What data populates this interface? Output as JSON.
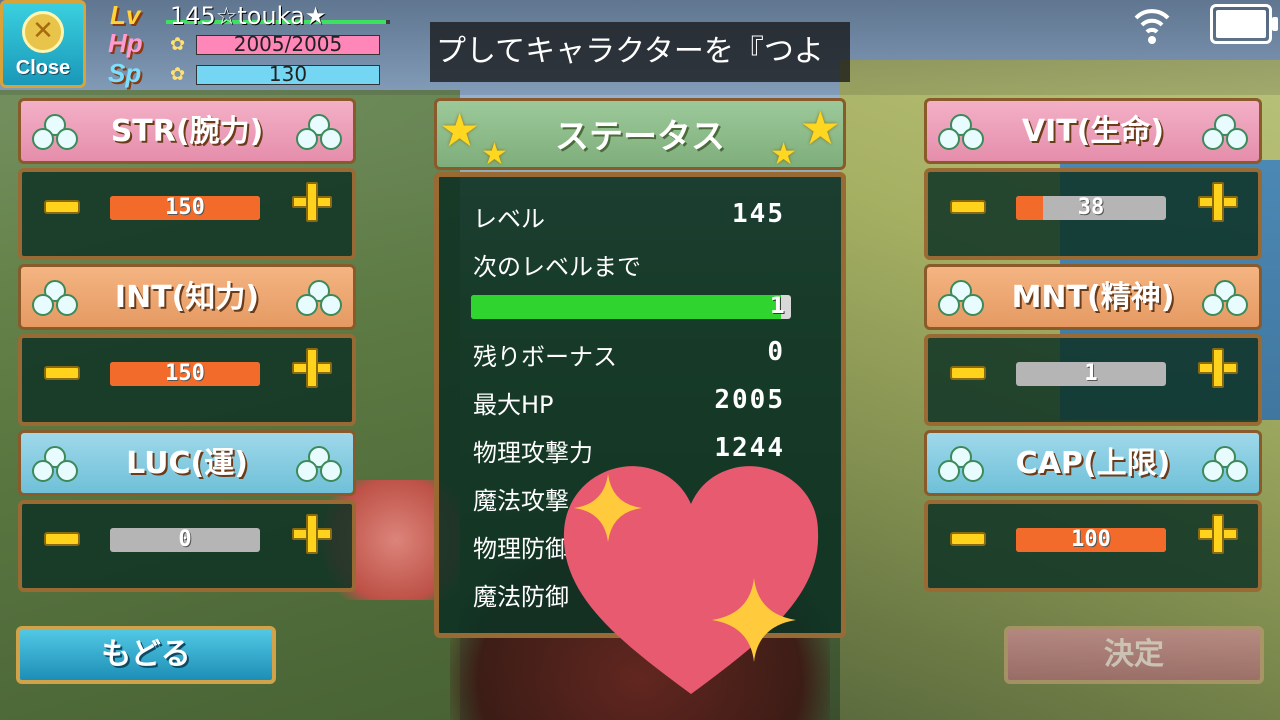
{
  "hud": {
    "close_label": "Close",
    "lv_key": "Lv",
    "hp_key": "Hp",
    "sp_key": "Sp",
    "level_name": "145☆touka★",
    "hp_text": "2005/2005",
    "sp_text": "130",
    "hp_fraction": 1.0,
    "sp_fraction": 1.0,
    "lv_fraction": 0.98,
    "ticker": "プしてキャラクターを『つよ"
  },
  "panels": {
    "str": {
      "title": "STR(腕力)",
      "value": "150",
      "fraction": 1.0
    },
    "int": {
      "title": "INT(知力)",
      "value": "150",
      "fraction": 1.0
    },
    "luc": {
      "title": "LUC(運)",
      "value": "0",
      "fraction": 0.0
    },
    "vit": {
      "title": "VIT(生命)",
      "value": "38",
      "fraction": 0.18
    },
    "mnt": {
      "title": "MNT(精神)",
      "value": "1",
      "fraction": 0.0
    },
    "cap": {
      "title": "CAP(上限)",
      "value": "100",
      "fraction": 1.0
    }
  },
  "status": {
    "title": "ステータス",
    "level_label": "レベル",
    "level_value": "145",
    "next_label": "次のレベルまで",
    "next_value": "1",
    "next_fraction": 0.97,
    "bonus_label": "残りボーナス",
    "bonus_value": "0",
    "maxhp_label": "最大HP",
    "maxhp_value": "2005",
    "patk_label": "物理攻撃力",
    "patk_value": "1244",
    "matk_label": "魔法攻撃",
    "pdef_label": "物理防御",
    "mdef_label": "魔法防御"
  },
  "buttons": {
    "back": "もどる",
    "confirm": "決定"
  },
  "colors": {
    "accent_orange": "#f26b2a",
    "xp_green": "#2fd42f",
    "button_yellow": "#ffd21c",
    "heart_pink": "#e85a70"
  },
  "icons": [
    "close-icon",
    "wifi-icon",
    "battery-icon",
    "leaf-icon",
    "star-icon",
    "heart-sticker",
    "sparkle-icon"
  ]
}
